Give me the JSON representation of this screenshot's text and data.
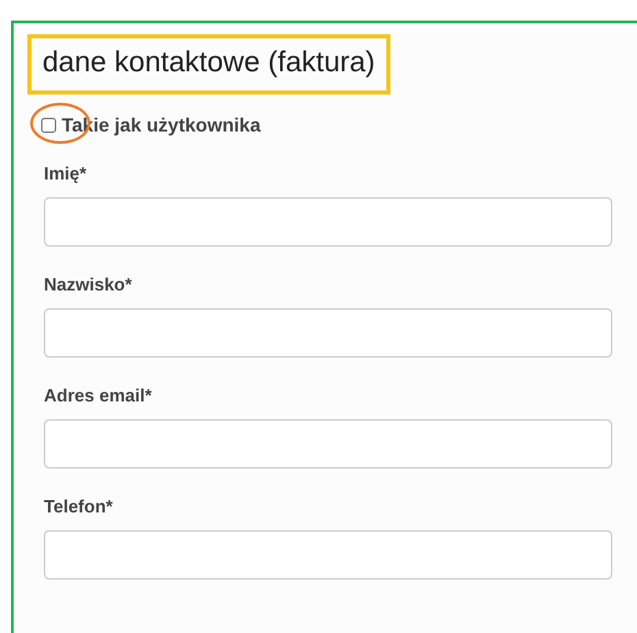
{
  "heading": {
    "text": "dane kontaktowe (faktura)",
    "highlighted": true
  },
  "same_as_user": {
    "label": "Takie jak użytkownika",
    "checked": false,
    "circled": true
  },
  "fields": [
    {
      "label": "Imię*"
    },
    {
      "label": "Nazwisko*"
    },
    {
      "label": "Adres email*"
    },
    {
      "label": "Telefon*"
    }
  ]
}
